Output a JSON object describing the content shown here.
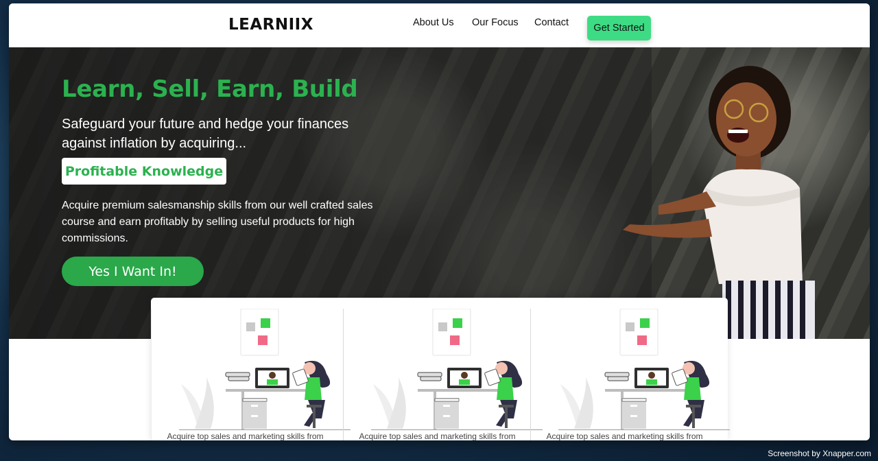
{
  "nav": {
    "logo": "LEARNIIX",
    "links": [
      "About Us",
      "Our Focus",
      "Contact"
    ],
    "cta": "Get Started"
  },
  "hero": {
    "title": "Learn, Sell, Earn, Build",
    "subtitle": "Safeguard your future and hedge your finances against inflation by acquiring...",
    "badge": "Profitable Knowledge",
    "description": "Acquire premium salesmanship skills from our well crafted sales course and earn profitably by selling useful products for high commissions.",
    "cta": "Yes I Want In!"
  },
  "cards": [
    {
      "text": "Acquire top sales and marketing skills from"
    },
    {
      "text": "Acquire top sales and marketing skills from"
    },
    {
      "text": "Acquire top sales and marketing skills from"
    }
  ],
  "colors": {
    "accent_green": "#2bb24f",
    "cta_green": "#3ddc84",
    "button_green": "#2aa84a"
  },
  "watermark": "Screenshot by Xnapper.com"
}
